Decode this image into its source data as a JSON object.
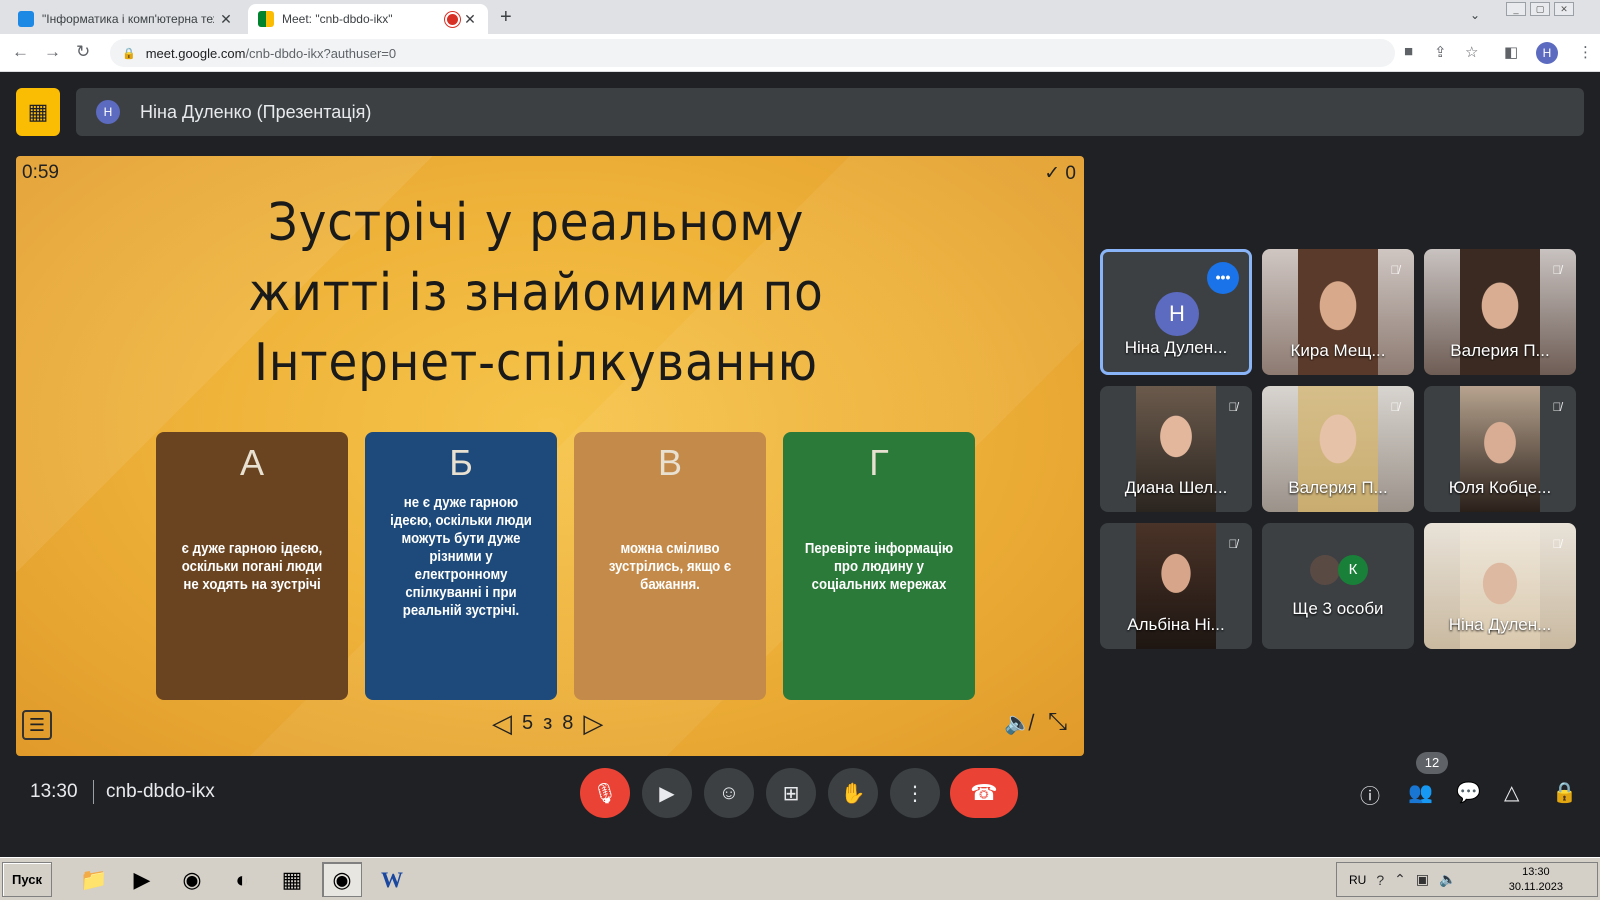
{
  "browser": {
    "tabs": [
      {
        "title": "\"Інформатика і комп'ютерна техні",
        "active": false
      },
      {
        "title": "Meet: \"cnb-dbdo-ikx\"",
        "active": true,
        "recording": true
      }
    ],
    "url": {
      "host": "meet.google.com",
      "path": "/cnb-dbdo-ikx?authuser=0"
    },
    "profile_initial": "Н"
  },
  "presentation": {
    "presenter_initial": "Н",
    "presenter_label": "Ніна Дуленко (Презентація)"
  },
  "slide": {
    "timer": "0:59",
    "score": "✓ 0",
    "title_lines": [
      "Зустрічі у реальному",
      "житті із знайомими по",
      "Інтернет-спілкуванню"
    ],
    "answers": [
      {
        "letter": "А",
        "text": "є дуже гарною ідеєю, оскільки погані люди не ходять на зустрічі",
        "color": "#6a4420"
      },
      {
        "letter": "Б",
        "text": "не є дуже гарною ідеєю, оскільки люди можуть бути дуже різними у електронному спілкуванні і при реальній зустрічі.",
        "color": "#1d4a7a"
      },
      {
        "letter": "В",
        "text": "можна сміливо зустрілись, якщо є бажання.",
        "color": "#c48a4a"
      },
      {
        "letter": "Г",
        "text": "Перевірте інформацію про людину у соціальних мережах",
        "color": "#2c7a3a"
      }
    ],
    "pager": {
      "current": "5",
      "sep": "з",
      "total": "8"
    }
  },
  "participants": [
    {
      "name": "Ніна Дулен...",
      "initial": "Н",
      "active": true
    },
    {
      "name": "Кира Мещ...",
      "muted": true
    },
    {
      "name": "Валерия П...",
      "muted": true
    },
    {
      "name": "Диана Шел...",
      "muted": true
    },
    {
      "name": "Валерия П...",
      "muted": true
    },
    {
      "name": "Юля Кобце...",
      "muted": true
    },
    {
      "name": "Альбіна Ні...",
      "muted": true
    },
    {
      "name": "Ще 3 особи",
      "extra_initial": "К"
    },
    {
      "name": "Ніна Дулен...",
      "muted": true
    }
  ],
  "controls": {
    "time": "13:30",
    "meeting_code": "cnb-dbdo-ikx",
    "people_count": "12"
  },
  "taskbar": {
    "start_label": "Пуск",
    "lang": "RU",
    "clock_time": "13:30",
    "clock_date": "30.11.2023"
  }
}
